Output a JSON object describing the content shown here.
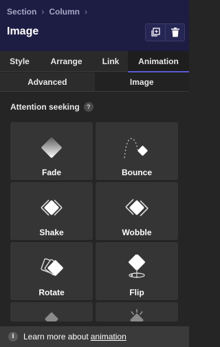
{
  "header": {
    "breadcrumb": [
      "Section",
      "Column"
    ],
    "title": "Image",
    "buttons": [
      {
        "icon": "duplicate-icon"
      },
      {
        "icon": "trash-icon"
      }
    ]
  },
  "tabs": [
    {
      "label": "Style"
    },
    {
      "label": "Arrange"
    },
    {
      "label": "Link"
    },
    {
      "label": "Animation",
      "active": true
    }
  ],
  "subtabs": [
    {
      "label": "Advanced",
      "active": true
    },
    {
      "label": "Image"
    }
  ],
  "section": {
    "title": "Attention seeking",
    "help": "?"
  },
  "animations": [
    {
      "label": "Fade",
      "icon": "fade-icon"
    },
    {
      "label": "Bounce",
      "icon": "bounce-icon"
    },
    {
      "label": "Shake",
      "icon": "shake-icon"
    },
    {
      "label": "Wobble",
      "icon": "wobble-icon"
    },
    {
      "label": "Rotate",
      "icon": "rotate-icon"
    },
    {
      "label": "Flip",
      "icon": "flip-icon"
    }
  ],
  "footer": {
    "info_icon": "i",
    "text": "Learn more about",
    "link": "animation"
  },
  "colors": {
    "header_bg": "#1d1d44",
    "accent": "#5a5ad6",
    "panel_bg": "#252525",
    "tile_bg": "#353535"
  }
}
